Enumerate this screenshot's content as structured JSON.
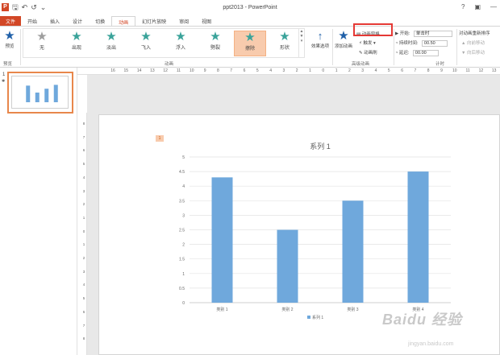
{
  "window": {
    "title": "ppt2013 - PowerPoint",
    "help": "?",
    "restore": "▣",
    "minimize": "—",
    "close": "✕"
  },
  "qat": {
    "app_logo": "P",
    "save": "🖫",
    "undo": "↶",
    "redo": "↺",
    "customize": "⌄"
  },
  "tabs": [
    "文件",
    "开始",
    "插入",
    "设计",
    "切换",
    "动画",
    "幻灯片放映",
    "审阅",
    "视图"
  ],
  "active_tab_index": 5,
  "ribbon": {
    "preview": {
      "label": "预览",
      "group": "预览"
    },
    "animations": [
      {
        "label": "无",
        "icon": "star-icon"
      },
      {
        "label": "出现",
        "icon": "star-icon"
      },
      {
        "label": "淡出",
        "icon": "star-icon"
      },
      {
        "label": "飞入",
        "icon": "star-icon"
      },
      {
        "label": "浮入",
        "icon": "star-icon"
      },
      {
        "label": "劈裂",
        "icon": "star-icon"
      },
      {
        "label": "擦除",
        "icon": "star-icon"
      },
      {
        "label": "形状",
        "icon": "star-icon"
      }
    ],
    "selected_animation_index": 6,
    "animation_group": "动画",
    "effect_options": "效果选项",
    "add_animation": "添加动画",
    "animation_pane": "动画窗格",
    "trigger": "触发",
    "anim_painter": "动画刷",
    "advanced_group": "高级动画",
    "start_label": "开始:",
    "start_value": "单击时",
    "duration_label": "持续时间:",
    "duration_value": "00.50",
    "delay_label": "延迟:",
    "delay_value": "00.00",
    "timing_group": "计时",
    "reorder_title": "对动画重新排序",
    "move_earlier": "▲ 向前移动",
    "move_later": "▼ 向后移动"
  },
  "ruler_labels": [
    "16",
    "15",
    "14",
    "13",
    "12",
    "11",
    "10",
    "9",
    "8",
    "7",
    "6",
    "5",
    "4",
    "3",
    "2",
    "1",
    "0",
    "1",
    "2",
    "3",
    "4",
    "5",
    "6",
    "7",
    "8",
    "9",
    "10",
    "11",
    "12",
    "13",
    "14"
  ],
  "vruler_labels": [
    "8",
    "7",
    "6",
    "5",
    "4",
    "3",
    "2",
    "1",
    "0",
    "1",
    "2",
    "3",
    "4",
    "5",
    "6",
    "7",
    "8"
  ],
  "thumbnail": {
    "number": "1",
    "star": "✱"
  },
  "slide": {
    "selection_tag": "1"
  },
  "colors": {
    "accent": "#d24726",
    "bar": "#6fa8dc",
    "highlight_box": "#e53935"
  },
  "chart_data": {
    "type": "bar",
    "title": "系列 1",
    "categories": [
      "类别 1",
      "类别 2",
      "类别 3",
      "类别 4"
    ],
    "series": [
      {
        "name": "系列 1",
        "values": [
          4.3,
          2.5,
          3.5,
          4.5
        ]
      }
    ],
    "ylim": [
      0,
      5
    ],
    "yticks": [
      "0",
      "0.5",
      "1",
      "1.5",
      "2",
      "2.5",
      "3",
      "3.5",
      "4",
      "4.5",
      "5"
    ],
    "grid": true,
    "legend": "bottom"
  },
  "watermark": {
    "main": "Baidu 经验",
    "sub": "jingyan.baidu.com"
  }
}
